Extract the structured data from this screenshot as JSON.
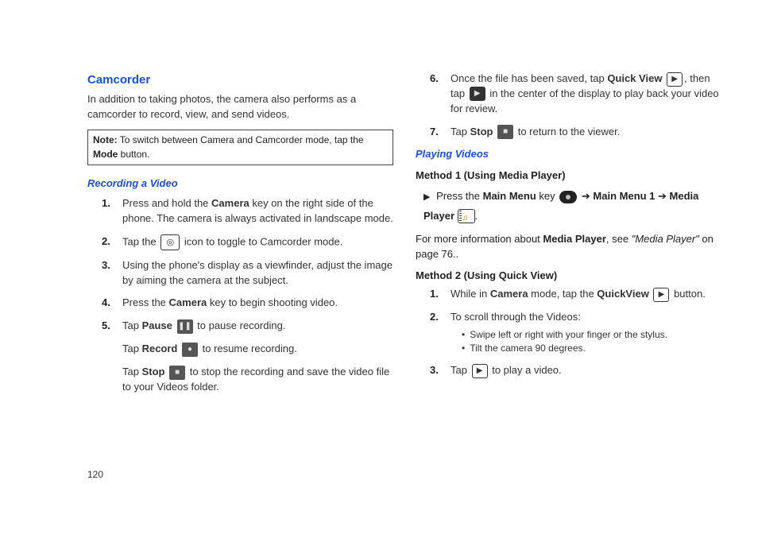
{
  "pageNumber": "120",
  "left": {
    "title": "Camcorder",
    "lead": "In addition to taking photos, the camera also performs as a camcorder to record, view, and send videos.",
    "note": {
      "label": "Note:",
      "text": " To switch between Camera and Camcorder mode, tap the ",
      "bold": "Mode",
      "text2": " button."
    },
    "sub": "Recording a Video",
    "s1": {
      "num": "1.",
      "a": "Press and hold the ",
      "b": "Camera",
      "c": " key on the right side of the phone. The camera is always activated in landscape mode."
    },
    "s2": {
      "num": "2.",
      "a": "Tap the ",
      "c": " icon to toggle to Camcorder mode."
    },
    "s3": {
      "num": "3.",
      "a": "Using the phone's display as a viewfinder, adjust the image by aiming the camera at the subject."
    },
    "s4": {
      "num": "4.",
      "a": "Press the ",
      "b": "Camera",
      "c": " key to begin shooting video."
    },
    "s5": {
      "num": "5.",
      "a": "Tap ",
      "b": "Pause",
      "c": " to pause recording.",
      "d": "Tap ",
      "e": "Record",
      "f": " to resume recording.",
      "g": "Tap ",
      "h": "Stop",
      "i": " to stop the recording and save the video file to your Videos folder."
    }
  },
  "right": {
    "s6": {
      "num": "6.",
      "a": "Once the file has been saved, tap ",
      "b": "Quick View",
      "c": ", then tap ",
      "d": " in the center of the display to play back your video for review."
    },
    "s7": {
      "num": "7.",
      "a": "Tap ",
      "b": "Stop",
      "c": " to return to the viewer."
    },
    "sub": "Playing Videos",
    "m1": "Method 1 (Using Media Player)",
    "press": {
      "a": "Press the ",
      "b": "Main Menu",
      "c": " key ",
      "arrow": " ➔ ",
      "d": "Main Menu 1",
      "arrow2": " ➔ ",
      "e": "Media Player",
      "dot": "."
    },
    "ref": {
      "a": "For more information about ",
      "b": "Media Player",
      "c": ", see ",
      "it": "\"Media Player\"",
      "d": " on page 76.."
    },
    "m2": "Method 2  (Using Quick View)",
    "q1": {
      "num": "1.",
      "a": "While in ",
      "b": "Camera",
      "c": " mode, tap the ",
      "d": "QuickView",
      "e": " button."
    },
    "q2": {
      "num": "2.",
      "a": "To scroll through the Videos:"
    },
    "q2b1": "Swipe left or right with your finger or the stylus.",
    "q2b2": "Tilt the camera 90 degrees.",
    "q3": {
      "num": "3.",
      "a": "Tap ",
      "c": " to play a video."
    }
  }
}
